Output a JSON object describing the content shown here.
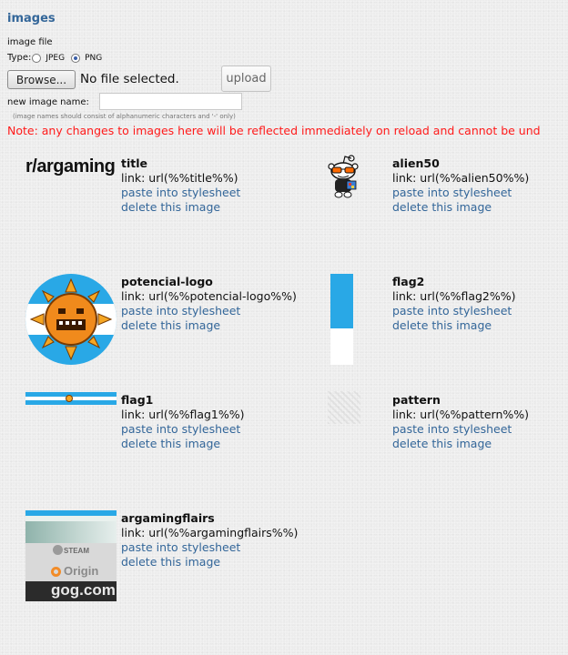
{
  "section_title": "images",
  "form": {
    "image_file_label": "image file",
    "type_label": "Type:",
    "type_options": [
      "JPEG",
      "PNG"
    ],
    "type_selected": "PNG",
    "browse_label": "Browse...",
    "file_status": "No file selected.",
    "upload_label": "upload",
    "name_label": "new image name:",
    "name_value": "",
    "name_hint": "(image names should consist of alphanumeric characters and '-' only)"
  },
  "note": "Note: any changes to images here will be reflected immediately on reload and cannot be und",
  "actions": {
    "paste": "paste into stylesheet",
    "delete": "delete this image"
  },
  "images": [
    {
      "name": "title",
      "link": "link: url(%%title%%)",
      "thumb_text": "r/argaming"
    },
    {
      "name": "alien50",
      "link": "link: url(%%alien50%%)"
    },
    {
      "name": "potencial-logo",
      "link": "link: url(%%potencial-logo%%)"
    },
    {
      "name": "flag2",
      "link": "link: url(%%flag2%%)"
    },
    {
      "name": "flag1",
      "link": "link: url(%%flag1%%)"
    },
    {
      "name": "pattern",
      "link": "link: url(%%pattern%%)"
    },
    {
      "name": "argamingflairs",
      "link": "link: url(%%argamingflairs%%)",
      "thumb_text": [
        "STEAM",
        "Origin",
        "gog.com"
      ]
    }
  ],
  "colors": {
    "link": "#336699",
    "heading": "#336699",
    "note": "#ff1a1a",
    "sky_blue": "#29a8e6"
  }
}
